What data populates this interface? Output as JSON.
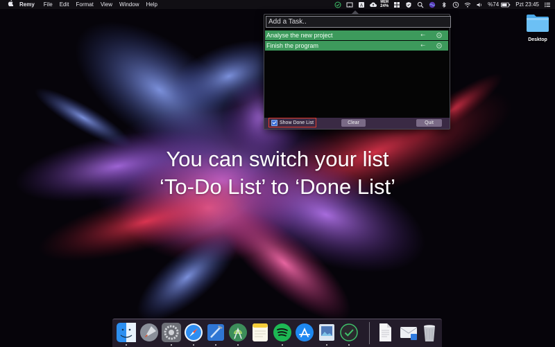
{
  "menubar": {
    "app_name": "Remy",
    "items": [
      "File",
      "Edit",
      "Format",
      "View",
      "Window",
      "Help"
    ],
    "memory_top": "MEM",
    "memory_value": "24%",
    "battery": "%74",
    "clock": "Pzt 23:45"
  },
  "desktop": {
    "folder_label": "Desktop"
  },
  "todo": {
    "input_placeholder": "Add a Task..",
    "tasks": [
      {
        "label": "Analyse the new project"
      },
      {
        "label": "Finish the program"
      }
    ],
    "back_arrow_glyph": "⇠",
    "show_done_label": "Show Done List",
    "clear_label": "Clear",
    "quit_label": "Quit",
    "task_color": "#3d9a5c",
    "highlight_color": "#e23b2e"
  },
  "caption": {
    "line1": "You can switch your list",
    "line2": "‘To-Do List’ to ‘Done List’"
  },
  "dock": {
    "icons": [
      "finder-icon",
      "launchpad-icon",
      "system-preferences-icon",
      "safari-icon",
      "xcode-icon",
      "android-studio-icon",
      "notes-icon",
      "spotify-icon",
      "app-store-icon",
      "preview-icon",
      "remy-check-icon",
      "document-icon",
      "mail-drop-icon",
      "trash-icon"
    ]
  }
}
